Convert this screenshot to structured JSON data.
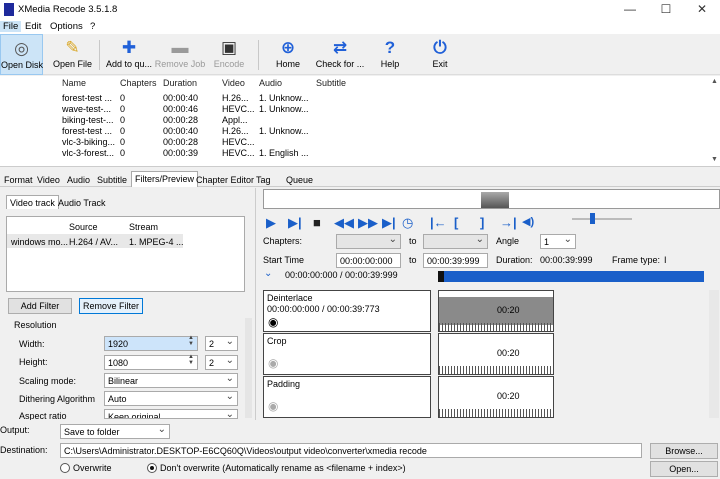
{
  "window": {
    "title": "XMedia Recode 3.5.1.8",
    "minimize": "—",
    "maximize": "☐",
    "close": "✕"
  },
  "menu": [
    "File",
    "Edit",
    "Options",
    "?"
  ],
  "toolbar": [
    {
      "label": "Open Disk",
      "icon": "disc-icon"
    },
    {
      "label": "Open File",
      "icon": "folder-icon"
    },
    {
      "label": "Add to qu...",
      "icon": "plus-icon"
    },
    {
      "label": "Remove Job",
      "icon": "minus-icon"
    },
    {
      "label": "Encode",
      "icon": "film-icon"
    },
    {
      "label": "Home",
      "icon": "globe-icon"
    },
    {
      "label": "Check for ...",
      "icon": "refresh-icon"
    },
    {
      "label": "Help",
      "icon": "question-icon"
    },
    {
      "label": "Exit",
      "icon": "power-icon"
    }
  ],
  "filelist": {
    "columns": [
      "Name",
      "Chapters",
      "Duration",
      "Video",
      "Audio",
      "Subtitle"
    ],
    "rows": [
      [
        "forest-test ...",
        "0",
        "00:00:40",
        "H.26...",
        "1. Unknow...",
        ""
      ],
      [
        "wave-test-...",
        "0",
        "00:00:46",
        "HEVC...",
        "1. Unknow...",
        ""
      ],
      [
        "biking-test-...",
        "0",
        "00:00:28",
        "Appl...",
        "",
        ""
      ],
      [
        "forest-test ...",
        "0",
        "00:00:40",
        "H.26...",
        "1. Unknow...",
        ""
      ],
      [
        "vlc-3-biking...",
        "0",
        "00:00:28",
        "HEVC...",
        "",
        ""
      ],
      [
        "vlc-3-forest...",
        "0",
        "00:00:39",
        "HEVC...",
        "1. English ...",
        ""
      ]
    ]
  },
  "tabs": [
    "Format",
    "Video",
    "Audio",
    "Subtitle",
    "Filters/Preview",
    "Chapter Editor",
    "Tag",
    "Queue"
  ],
  "subtabs": [
    "Video track",
    "Audio Track"
  ],
  "track": {
    "columns": [
      "Source",
      "Stream"
    ],
    "row": [
      "windows mo...",
      "H.264 / AV...",
      "1. MPEG-4 ..."
    ]
  },
  "buttons": {
    "add_filter": "Add Filter",
    "remove_filter": "Remove Filter",
    "browse": "Browse...",
    "open": "Open..."
  },
  "resolution": {
    "group": "Resolution",
    "width_label": "Width:",
    "width": "1920",
    "width_div": "2",
    "height_label": "Height:",
    "height": "1080",
    "height_div": "2",
    "scaling_label": "Scaling mode:",
    "scaling": "Bilinear",
    "dither_label": "Dithering Algorithm",
    "dither": "Auto",
    "aspect_label": "Aspect ratio",
    "aspect": "Keep original"
  },
  "preview": {
    "chapters_label": "Chapters:",
    "to": "to",
    "angle_label": "Angle",
    "angle": "1",
    "start_label": "Start Time",
    "start": "00:00:00:000",
    "end": "00:00:39:999",
    "duration_label": "Duration:",
    "duration": "00:00:39:999",
    "frametype_label": "Frame type:",
    "frametype": "I",
    "range": "00:00:00:000 / 00:00:39:999"
  },
  "filters": [
    {
      "name": "Deinterlace",
      "range": "00:00:00:000 / 00:00:39:773",
      "time": "00:20",
      "active": true
    },
    {
      "name": "Crop",
      "range": "",
      "time": "00:20",
      "active": false
    },
    {
      "name": "Padding",
      "range": "",
      "time": "00:20",
      "active": false
    }
  ],
  "output": {
    "output_label": "Output:",
    "output": "Save to folder",
    "dest_label": "Destination:",
    "dest": "C:\\Users\\Administrator.DESKTOP-E6CQ60Q\\Videos\\output video\\converter\\xmedia recode",
    "overwrite": "Overwrite",
    "no_overwrite": "Don't overwrite (Automatically rename as <filename + index>)"
  }
}
